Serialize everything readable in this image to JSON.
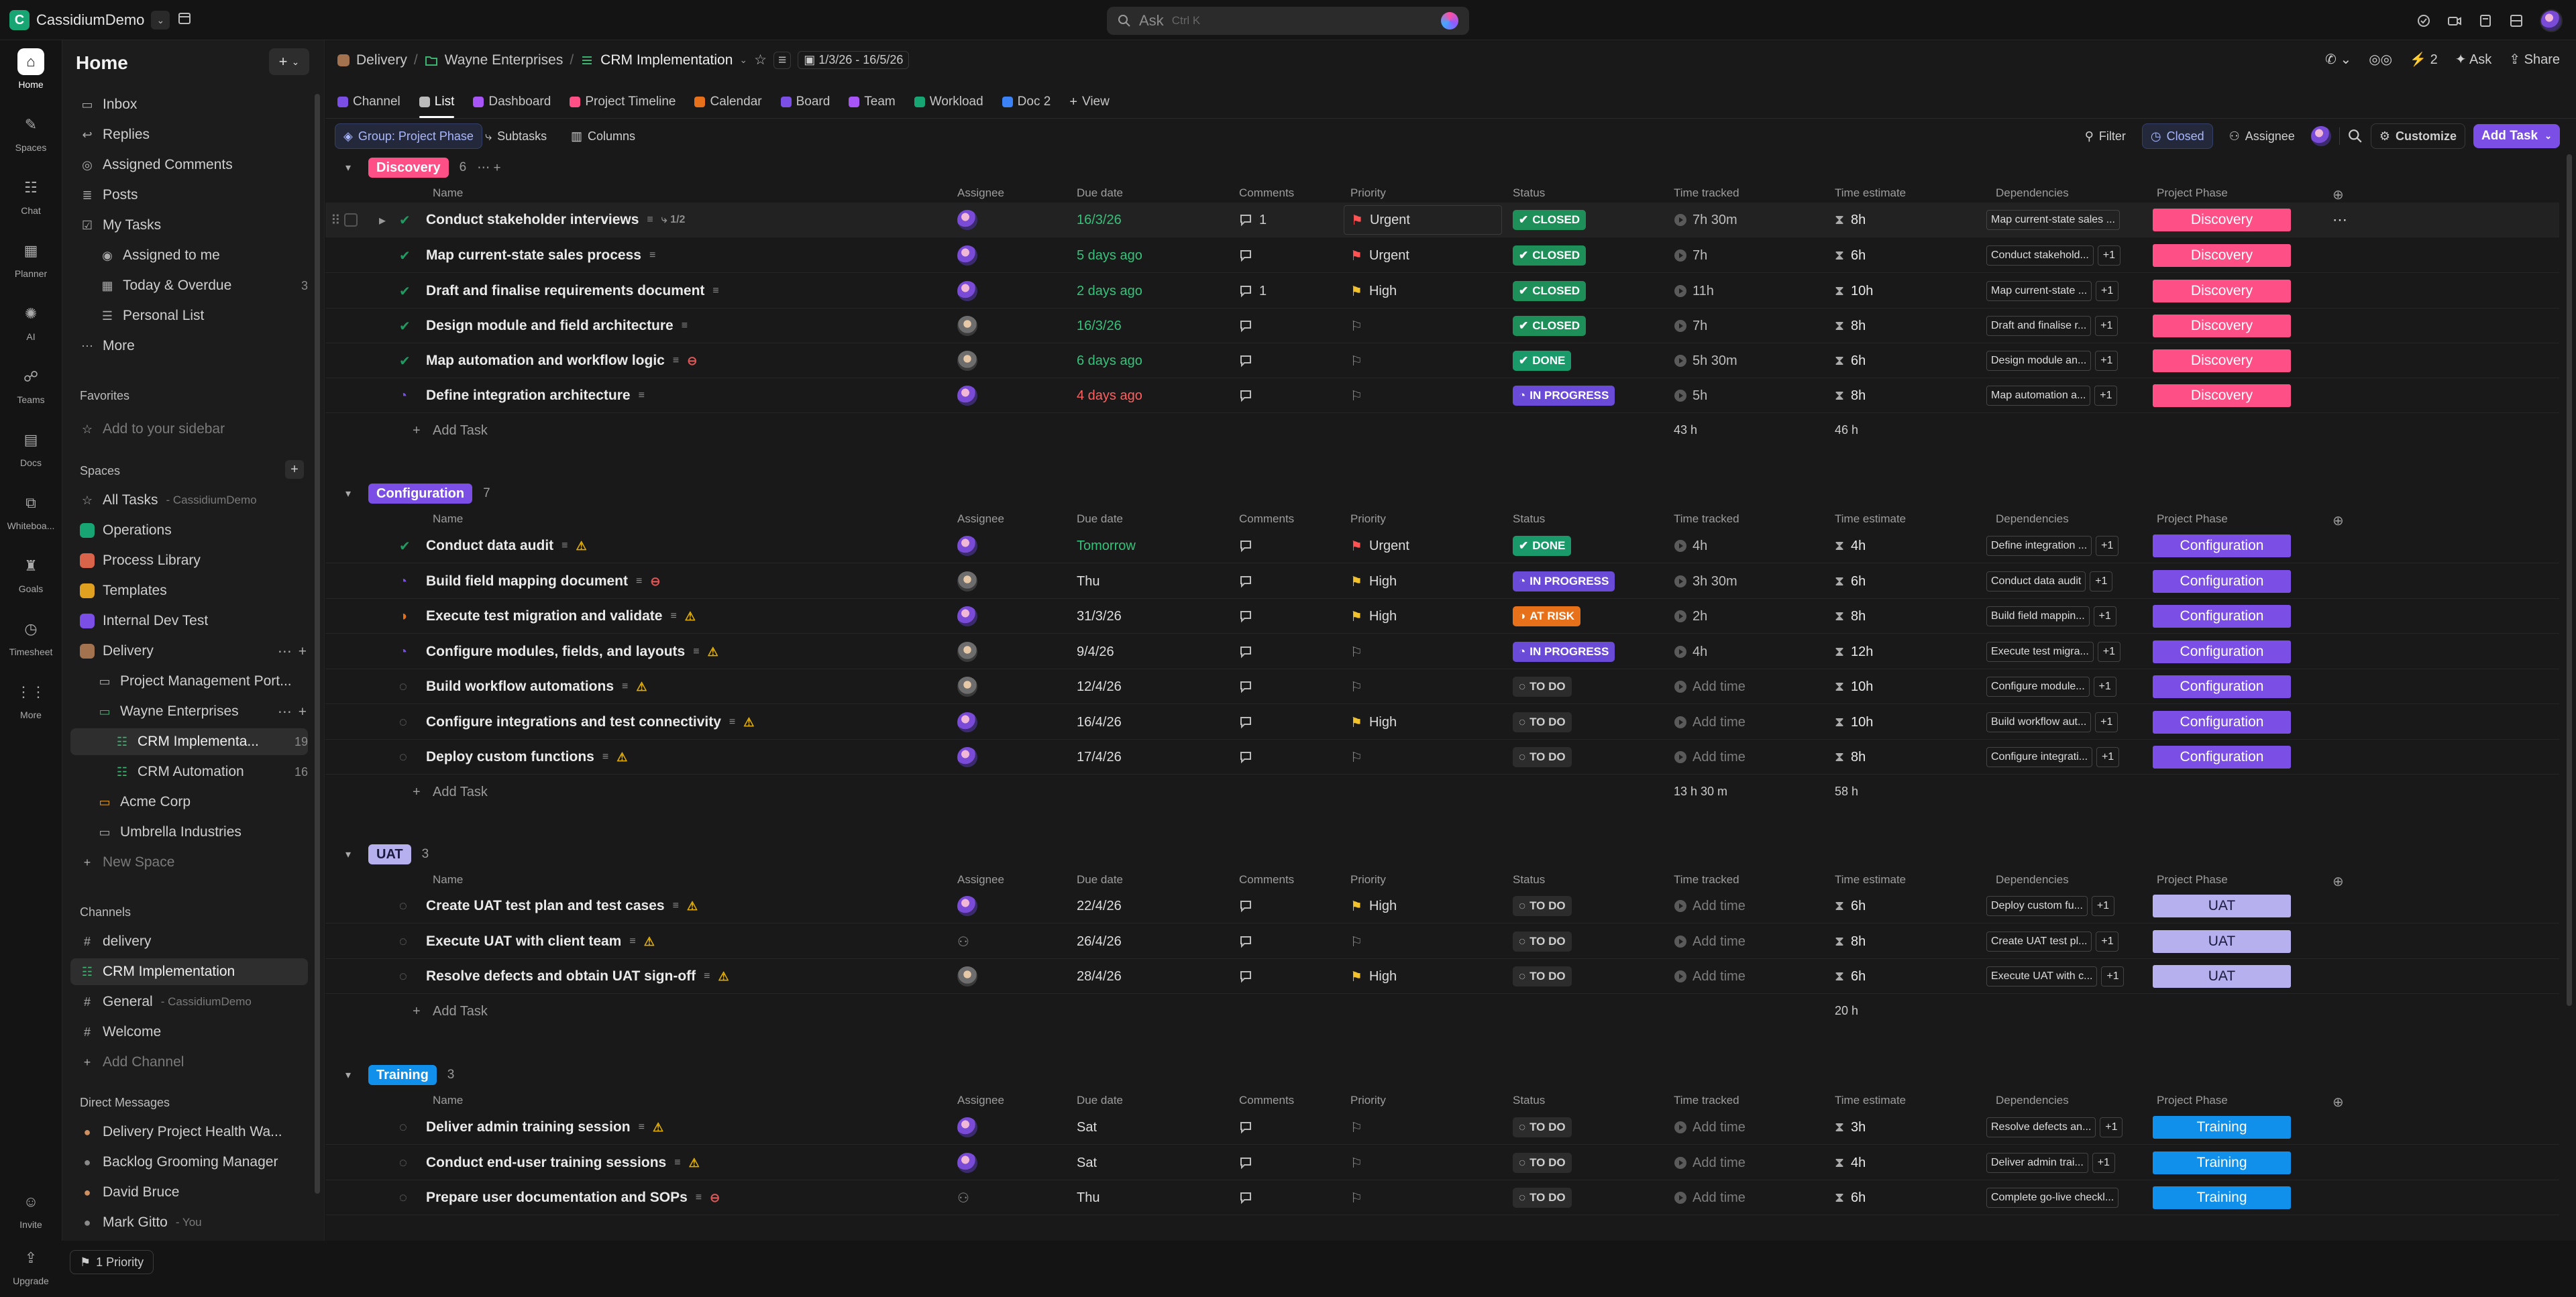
{
  "topbar": {
    "workspace_initial": "C",
    "workspace_name": "CassidiumDemo",
    "search_placeholder": "Ask",
    "search_shortcut": "Ctrl K"
  },
  "rail": [
    {
      "label": "Home",
      "icon": "home-icon",
      "active": true
    },
    {
      "label": "Spaces",
      "icon": "spaces-icon"
    },
    {
      "label": "Chat",
      "icon": "chat-icon"
    },
    {
      "label": "Planner",
      "icon": "planner-icon"
    },
    {
      "label": "AI",
      "icon": "ai-icon"
    },
    {
      "label": "Teams",
      "icon": "teams-icon"
    },
    {
      "label": "Docs",
      "icon": "docs-icon"
    },
    {
      "label": "Whiteboa...",
      "icon": "whiteboard-icon"
    },
    {
      "label": "Goals",
      "icon": "goals-icon"
    },
    {
      "label": "Timesheet",
      "icon": "timesheet-icon"
    },
    {
      "label": "More",
      "icon": "more-icon"
    },
    {
      "label": "Invite",
      "icon": "invite-icon"
    },
    {
      "label": "Upgrade",
      "icon": "upgrade-icon"
    }
  ],
  "sidebar": {
    "title": "Home",
    "new_label": "+",
    "home_items": [
      {
        "label": "Inbox"
      },
      {
        "label": "Replies"
      },
      {
        "label": "Assigned Comments"
      },
      {
        "label": "Posts"
      },
      {
        "label": "My Tasks"
      },
      {
        "label": "Assigned to me"
      },
      {
        "label": "Today & Overdue",
        "count": "3"
      },
      {
        "label": "Personal List"
      },
      {
        "label": "More"
      }
    ],
    "favorites_title": "Favorites",
    "favorites_placeholder": "Add to your sidebar",
    "spaces_title": "Spaces",
    "spaces": [
      {
        "label": "All Tasks",
        "sub": "- CassidiumDemo"
      },
      {
        "label": "Operations"
      },
      {
        "label": "Process Library"
      },
      {
        "label": "Templates"
      },
      {
        "label": "Internal Dev Test"
      },
      {
        "label": "Delivery"
      },
      {
        "label": "Project Management Port..."
      },
      {
        "label": "Wayne Enterprises"
      },
      {
        "label": "CRM Implementa...",
        "count": "19"
      },
      {
        "label": "CRM Automation",
        "count": "16"
      },
      {
        "label": "Acme Corp"
      },
      {
        "label": "Umbrella Industries"
      },
      {
        "label": "New Space"
      }
    ],
    "channels_title": "Channels",
    "channels": [
      {
        "label": "delivery"
      },
      {
        "label": "CRM Implementation"
      },
      {
        "label": "General",
        "sub": "- CassidiumDemo"
      },
      {
        "label": "Welcome"
      },
      {
        "label": "Add Channel"
      }
    ],
    "dm_title": "Direct Messages",
    "dms": [
      {
        "label": "Delivery Project Health Wa..."
      },
      {
        "label": "Backlog Grooming Manager"
      },
      {
        "label": "David Bruce"
      },
      {
        "label": "Mark Gitto",
        "sub": "- You"
      }
    ]
  },
  "breadcrumb": [
    "Delivery",
    "Wayne Enterprises",
    "CRM Implementation"
  ],
  "date_range": "1/3/26 - 16/5/26",
  "header_actions": {
    "count": "2",
    "ask": "Ask",
    "share": "Share"
  },
  "views": [
    "Channel",
    "List",
    "Dashboard",
    "Project Timeline",
    "Calendar",
    "Board",
    "Team",
    "Workload",
    "Doc 2",
    "View"
  ],
  "toolbar": {
    "group": "Group: Project Phase",
    "subtasks": "Subtasks",
    "columns": "Columns",
    "filter": "Filter",
    "closed": "Closed",
    "assignee": "Assignee",
    "customize": "Customize",
    "add_task": "Add Task"
  },
  "columns": {
    "name": "Name",
    "assignee": "Assignee",
    "due": "Due date",
    "comments": "Comments",
    "priority": "Priority",
    "status": "Status",
    "tracked": "Time tracked",
    "estimate": "Time estimate",
    "deps": "Dependencies",
    "phase": "Project Phase"
  },
  "add_task_label": "Add Task",
  "add_time_label": "Add time",
  "bottom_priority": "1 Priority",
  "colors": {
    "discovery": "#ff4f87",
    "configuration": "#7b4fe6",
    "uat": "#b6b0ee",
    "training": "#1090ea"
  },
  "groups": [
    {
      "name": "Discovery",
      "count": "6",
      "color": "#ff4f87",
      "tracked_total": "43 h",
      "estimate_total": "46 h",
      "tasks": [
        {
          "name": "Conduct stakeholder interviews",
          "subtasks": "1/2",
          "state": "closed",
          "due": "16/3/26",
          "due_color": "g",
          "comments": "1",
          "priority": "Urgent",
          "status": "CLOSED",
          "tracked": "7h 30m",
          "estimate": "8h",
          "dep": "Map current-state sales ...",
          "dep_more": "",
          "avatar": "a"
        },
        {
          "name": "Map current-state sales process",
          "state": "closed",
          "due": "5 days ago",
          "due_color": "g",
          "comments": "",
          "priority": "Urgent",
          "status": "CLOSED",
          "tracked": "7h",
          "estimate": "6h",
          "dep": "Conduct stakehold...",
          "dep_more": "+1",
          "avatar": "a"
        },
        {
          "name": "Draft and finalise requirements document",
          "state": "closed",
          "due": "2 days ago",
          "due_color": "g",
          "comments": "1",
          "priority": "High",
          "status": "CLOSED",
          "tracked": "11h",
          "estimate": "10h",
          "dep": "Map current-state ...",
          "dep_more": "+1",
          "avatar": "a"
        },
        {
          "name": "Design module and field architecture",
          "state": "closed",
          "due": "16/3/26",
          "due_color": "g",
          "comments": "",
          "priority": "",
          "status": "CLOSED",
          "tracked": "7h",
          "estimate": "8h",
          "dep": "Draft and finalise r...",
          "dep_more": "+1",
          "avatar": "b"
        },
        {
          "name": "Map automation and workflow logic",
          "state": "closed",
          "blocked": true,
          "due": "6 days ago",
          "due_color": "g",
          "comments": "",
          "priority": "",
          "status": "DONE",
          "tracked": "5h 30m",
          "estimate": "6h",
          "dep": "Design module an...",
          "dep_more": "+1",
          "avatar": "b"
        },
        {
          "name": "Define integration architecture",
          "state": "progress",
          "due": "4 days ago",
          "due_color": "r",
          "comments": "",
          "priority": "",
          "status": "IN PROGRESS",
          "tracked": "5h",
          "estimate": "8h",
          "dep": "Map automation a...",
          "dep_more": "+1",
          "avatar": "a"
        }
      ]
    },
    {
      "name": "Configuration",
      "count": "7",
      "color": "#7b4fe6",
      "tracked_total": "13 h 30 m",
      "estimate_total": "58 h",
      "tasks": [
        {
          "name": "Conduct data audit",
          "warn": true,
          "state": "closed",
          "due": "Tomorrow",
          "due_color": "g",
          "comments": "",
          "priority": "Urgent",
          "status": "DONE",
          "tracked": "4h",
          "estimate": "4h",
          "dep": "Define integration ...",
          "dep_more": "+1",
          "avatar": "a"
        },
        {
          "name": "Build field mapping document",
          "blocked": true,
          "state": "progress",
          "due": "Thu",
          "due_color": "n",
          "comments": "",
          "priority": "High",
          "status": "IN PROGRESS",
          "tracked": "3h 30m",
          "estimate": "6h",
          "dep": "Conduct data audit",
          "dep_more": "+1",
          "avatar": "b"
        },
        {
          "name": "Execute test migration and validate",
          "warn": true,
          "state": "risk",
          "due": "31/3/26",
          "due_color": "n",
          "comments": "",
          "priority": "High",
          "status": "AT RISK",
          "tracked": "2h",
          "estimate": "8h",
          "dep": "Build field mappin...",
          "dep_more": "+1",
          "avatar": "a"
        },
        {
          "name": "Configure modules, fields, and layouts",
          "warn": true,
          "state": "progress",
          "due": "9/4/26",
          "due_color": "n",
          "comments": "",
          "priority": "",
          "status": "IN PROGRESS",
          "tracked": "4h",
          "estimate": "12h",
          "dep": "Execute test migra...",
          "dep_more": "+1",
          "avatar": "b"
        },
        {
          "name": "Build workflow automations",
          "warn": true,
          "state": "todo",
          "due": "12/4/26",
          "due_color": "n",
          "comments": "",
          "priority": "",
          "status": "TO DO",
          "tracked": "",
          "estimate": "10h",
          "dep": "Configure module...",
          "dep_more": "+1",
          "avatar": "b"
        },
        {
          "name": "Configure integrations and test connectivity",
          "warn": true,
          "state": "todo",
          "due": "16/4/26",
          "due_color": "n",
          "comments": "",
          "priority": "High",
          "status": "TO DO",
          "tracked": "",
          "estimate": "10h",
          "dep": "Build workflow aut...",
          "dep_more": "+1",
          "avatar": "a"
        },
        {
          "name": "Deploy custom functions",
          "warn": true,
          "state": "todo",
          "due": "17/4/26",
          "due_color": "n",
          "comments": "",
          "priority": "",
          "status": "TO DO",
          "tracked": "",
          "estimate": "8h",
          "dep": "Configure integrati...",
          "dep_more": "+1",
          "avatar": "a"
        }
      ]
    },
    {
      "name": "UAT",
      "count": "3",
      "color": "#b6b0ee",
      "tracked_total": "",
      "estimate_total": "20 h",
      "tasks": [
        {
          "name": "Create UAT test plan and test cases",
          "warn": true,
          "state": "todo",
          "due": "22/4/26",
          "due_color": "n",
          "comments": "",
          "priority": "High",
          "status": "TO DO",
          "tracked": "",
          "estimate": "6h",
          "dep": "Deploy custom fu...",
          "dep_more": "+1",
          "avatar": "a"
        },
        {
          "name": "Execute UAT with client team",
          "warn": true,
          "state": "todo",
          "due": "26/4/26",
          "due_color": "n",
          "comments": "",
          "priority": "",
          "status": "TO DO",
          "tracked": "",
          "estimate": "8h",
          "dep": "Create UAT test pl...",
          "dep_more": "+1",
          "avatar": "none"
        },
        {
          "name": "Resolve defects and obtain UAT sign-off",
          "warn": true,
          "state": "todo",
          "due": "28/4/26",
          "due_color": "n",
          "comments": "",
          "priority": "High",
          "status": "TO DO",
          "tracked": "",
          "estimate": "6h",
          "dep": "Execute UAT with c...",
          "dep_more": "+1",
          "avatar": "b"
        }
      ]
    },
    {
      "name": "Training",
      "count": "3",
      "color": "#1090ea",
      "tracked_total": "",
      "estimate_total": "",
      "tasks": [
        {
          "name": "Deliver admin training session",
          "warn": true,
          "state": "todo",
          "due": "Sat",
          "due_color": "n",
          "comments": "",
          "priority": "",
          "status": "TO DO",
          "tracked": "",
          "estimate": "3h",
          "dep": "Resolve defects an...",
          "dep_more": "+1",
          "avatar": "a"
        },
        {
          "name": "Conduct end-user training sessions",
          "warn": true,
          "state": "todo",
          "due": "Sat",
          "due_color": "n",
          "comments": "",
          "priority": "",
          "status": "TO DO",
          "tracked": "",
          "estimate": "4h",
          "dep": "Deliver admin trai...",
          "dep_more": "+1",
          "avatar": "a"
        },
        {
          "name": "Prepare user documentation and SOPs",
          "blocked": true,
          "state": "todo",
          "due": "Thu",
          "due_color": "n",
          "comments": "",
          "priority": "",
          "status": "TO DO",
          "tracked": "",
          "estimate": "6h",
          "dep": "Complete go-live checkl...",
          "dep_more": "",
          "avatar": "none"
        }
      ]
    }
  ]
}
